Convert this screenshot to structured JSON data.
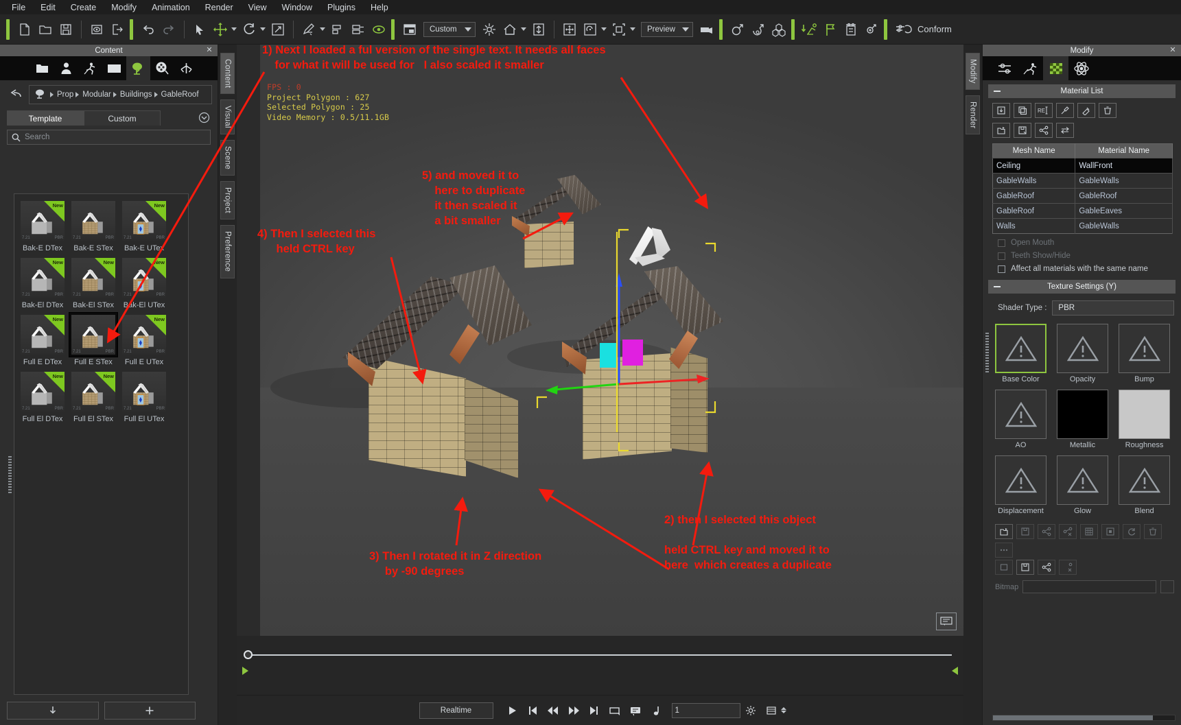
{
  "menubar": {
    "items": [
      "File",
      "Edit",
      "Create",
      "Modify",
      "Animation",
      "Render",
      "View",
      "Window",
      "Plugins",
      "Help"
    ]
  },
  "toolbar": {
    "new_label": "new-file",
    "open_label": "open-file",
    "save_label": "save-file",
    "preview_combo": "Custom",
    "render_combo": "Preview",
    "conform_label": "Conform"
  },
  "content_panel": {
    "title": "Content",
    "close_label": "✕",
    "breadcrumb": [
      "Prop",
      "Modular",
      "Buildings",
      "GableRoof"
    ],
    "tabs": [
      {
        "label": "Template",
        "active": true
      },
      {
        "label": "Custom",
        "active": false
      }
    ],
    "search": {
      "value": "",
      "placeholder": "Search"
    },
    "assets": [
      {
        "label": "Bak-E DTex",
        "new": true,
        "kind": "plain",
        "selected": false
      },
      {
        "label": "Bak-E STex",
        "new": false,
        "kind": "brick",
        "selected": false
      },
      {
        "label": "Bak-E UTex",
        "new": true,
        "kind": "door",
        "selected": false
      },
      {
        "label": "Bak-El DTex",
        "new": true,
        "kind": "plain",
        "selected": false
      },
      {
        "label": "Bak-El STex",
        "new": true,
        "kind": "brick",
        "selected": false
      },
      {
        "label": "Bak-El UTex",
        "new": true,
        "kind": "door",
        "selected": false
      },
      {
        "label": "Full E DTex",
        "new": true,
        "kind": "plain",
        "selected": false
      },
      {
        "label": "Full E STex",
        "new": false,
        "kind": "brick",
        "selected": true
      },
      {
        "label": "Full E UTex",
        "new": true,
        "kind": "door",
        "selected": false
      },
      {
        "label": "Full El DTex",
        "new": true,
        "kind": "plain",
        "selected": false
      },
      {
        "label": "Full El STex",
        "new": true,
        "kind": "brick",
        "selected": false
      },
      {
        "label": "Full El UTex",
        "new": false,
        "kind": "door",
        "selected": false
      }
    ],
    "thumb_version": "7.21",
    "thumb_badge": "PBR",
    "new_badge": "New",
    "bottom_buttons": [
      {
        "name": "download-button",
        "glyph": "↓"
      },
      {
        "name": "add-button",
        "glyph": "+"
      }
    ]
  },
  "left_vtabs": [
    {
      "label": "Content",
      "active": true
    },
    {
      "label": "Visual",
      "active": false
    },
    {
      "label": "Scene",
      "active": false
    },
    {
      "label": "Project",
      "active": false
    },
    {
      "label": "Preference",
      "active": false
    }
  ],
  "right_vtabs": [
    {
      "label": "Modify",
      "active": true
    },
    {
      "label": "Render",
      "active": false
    }
  ],
  "viewport": {
    "hud": [
      "FPS : 0",
      "Project Polygon : 627",
      "Selected Polygon : 25",
      "Video Memory : 0.5/11.1GB"
    ]
  },
  "timeline": {
    "realtime_label": "Realtime",
    "frame_value": "1",
    "buttons": [
      {
        "name": "play-button"
      },
      {
        "name": "jump-to-start-button"
      },
      {
        "name": "rewind-button"
      },
      {
        "name": "fast-forward-button"
      },
      {
        "name": "jump-to-end-button"
      },
      {
        "name": "loop-range-button"
      },
      {
        "name": "comment-button"
      },
      {
        "name": "audio-button"
      }
    ]
  },
  "modify_panel": {
    "title": "Modify",
    "close_label": "✕",
    "material_list_header": "Material List",
    "columns": [
      "Mesh Name",
      "Material Name"
    ],
    "rows": [
      {
        "mesh": "Ceiling",
        "material": "WallFront",
        "selected": true
      },
      {
        "mesh": "GableWalls",
        "material": "GableWalls",
        "selected": false
      },
      {
        "mesh": "GableRoof",
        "material": "GableRoof",
        "selected": false
      },
      {
        "mesh": "GableRoof",
        "material": "GableEaves",
        "selected": false
      },
      {
        "mesh": "Walls",
        "material": "GableWalls",
        "selected": false
      }
    ],
    "checkboxes": [
      {
        "label": "Open Mouth",
        "checked": false,
        "disabled": true
      },
      {
        "label": "Teeth Show/Hide",
        "checked": false,
        "disabled": true
      },
      {
        "label": "Affect all materials with the same name",
        "checked": false,
        "disabled": false
      }
    ],
    "texture_settings_header": "Texture Settings (Y)",
    "shader_type_label": "Shader Type :",
    "shader_type_value": "PBR",
    "texture_slots": [
      {
        "label": "Base Color",
        "state": "warning",
        "selected": true
      },
      {
        "label": "Opacity",
        "state": "warning",
        "selected": false
      },
      {
        "label": "Bump",
        "state": "warning",
        "selected": false
      },
      {
        "label": "AO",
        "state": "warning",
        "selected": false
      },
      {
        "label": "Metallic",
        "state": "black",
        "selected": false
      },
      {
        "label": "Roughness",
        "state": "grey",
        "selected": false
      },
      {
        "label": "Displacement",
        "state": "warning",
        "selected": false
      },
      {
        "label": "Glow",
        "state": "warning",
        "selected": false
      },
      {
        "label": "Blend",
        "state": "warning",
        "selected": false
      }
    ],
    "bitmap_label": "Bitmap"
  },
  "annotations": [
    {
      "id": "note1",
      "text": "1) Next I loaded a ful version of the single text. It needs all faces\n    for what it will be used for   I also scaled it smaller"
    },
    {
      "id": "note2",
      "text": "2) then I selected this object\n\nheld CTRL key and moved it to\nhere  which creates a duplicate"
    },
    {
      "id": "note3",
      "text": "3) Then I rotated it in Z direction\n     by -90 degrees"
    },
    {
      "id": "note4",
      "text": "4) Then I selected this\n      held CTRL key"
    },
    {
      "id": "note5",
      "text": "5) and moved it to\n    here to duplicate\n    it then scaled it\n    a bit smaller"
    }
  ],
  "colors": {
    "accent": "#8ec63f",
    "annotation": "#f41b0e",
    "hud_fps": "#c23c28",
    "hud_text": "#d8cb4a",
    "panel_bg": "#2e2e2e",
    "viewport_bg": "#4b4b4b"
  }
}
